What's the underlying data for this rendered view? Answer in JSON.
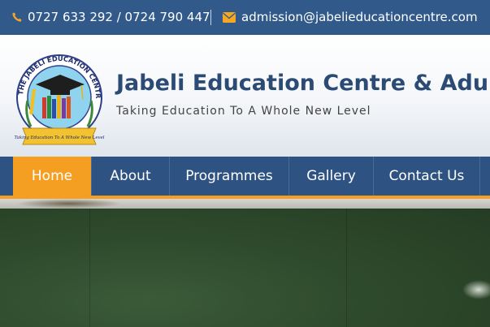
{
  "topbar": {
    "phone": "0727 633 292 / 0724 790 447",
    "phone_icon": "phone-icon",
    "email": "admission@jabelieducationcentre.com",
    "email_icon": "envelope-icon"
  },
  "header": {
    "logo_ring_text": "THE JABELI EDUCATION CENTRE",
    "logo_banner_text": "Taking Education To A Whole New Level",
    "title": "Jabeli Education Centre & Adult",
    "tagline": "Taking Education To A Whole New Level"
  },
  "nav": {
    "items": [
      {
        "label": "Home",
        "active": true
      },
      {
        "label": "About",
        "active": false
      },
      {
        "label": "Programmes",
        "active": false
      },
      {
        "label": "Gallery",
        "active": false
      },
      {
        "label": "Contact Us",
        "active": false
      }
    ]
  },
  "colors": {
    "topbar_bg": "#31598a",
    "nav_bg": "#2e5383",
    "accent": "#f59f22",
    "title": "#2b4a74"
  }
}
